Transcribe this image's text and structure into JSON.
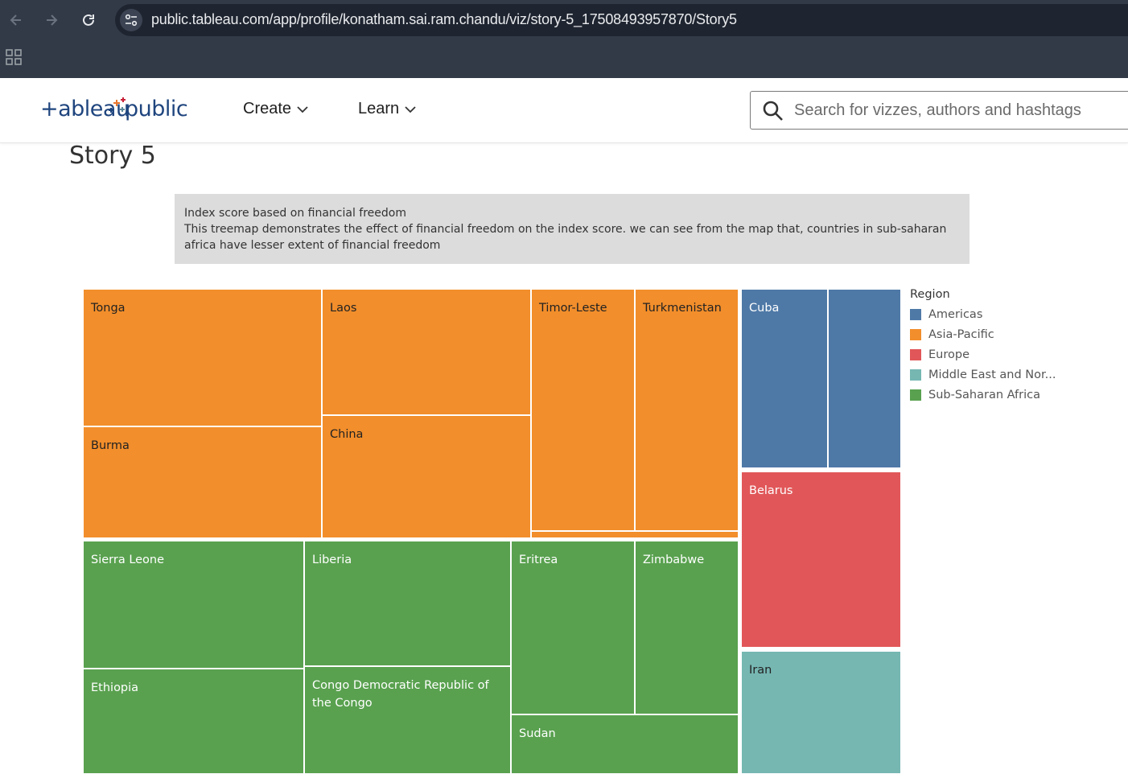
{
  "browser": {
    "url": "public.tableau.com/app/profile/konatham.sai.ram.chandu/viz/story-5_17508493957870/Story5"
  },
  "header": {
    "logo_text": "+ableau+public",
    "menu": [
      {
        "label": "Create"
      },
      {
        "label": "Learn"
      }
    ],
    "search_placeholder": "Search for vizzes, authors and hashtags"
  },
  "story": {
    "title": "Story 5",
    "caption_title": "Index score based on financial freedom",
    "caption_body": "This treemap demonstrates the effect of financial freedom on the index score. we can see from the map that, countries in sub-saharan africa have lesser extent of financial freedom"
  },
  "colors": {
    "Americas": "#4e79a7",
    "Asia-Pacific": "#f28e2b",
    "Europe": "#e15759",
    "Middle East and Nor...": "#76b7b2",
    "Sub-Saharan Africa": "#59a14f"
  },
  "chart_data": {
    "type": "treemap",
    "legend": {
      "title": "Region",
      "items": [
        "Americas",
        "Asia-Pacific",
        "Europe",
        "Middle East and Nor...",
        "Sub-Saharan Africa"
      ],
      "placement": "right"
    },
    "regions": [
      {
        "name": "Asia-Pacific",
        "countries": [
          "Tonga",
          "Burma",
          "Laos",
          "China",
          "Timor-Leste",
          "Turkmenistan",
          ""
        ]
      },
      {
        "name": "Sub-Saharan Africa",
        "countries": [
          "Sierra Leone",
          "Ethiopia",
          "Liberia",
          "Congo Democratic Republic of the Congo",
          "Eritrea",
          "Zimbabwe",
          "Sudan"
        ]
      },
      {
        "name": "Americas",
        "countries": [
          "Cuba",
          ""
        ]
      },
      {
        "name": "Europe",
        "countries": [
          "Belarus"
        ]
      },
      {
        "name": "Middle East and Nor...",
        "countries": [
          "Iran"
        ]
      }
    ]
  }
}
